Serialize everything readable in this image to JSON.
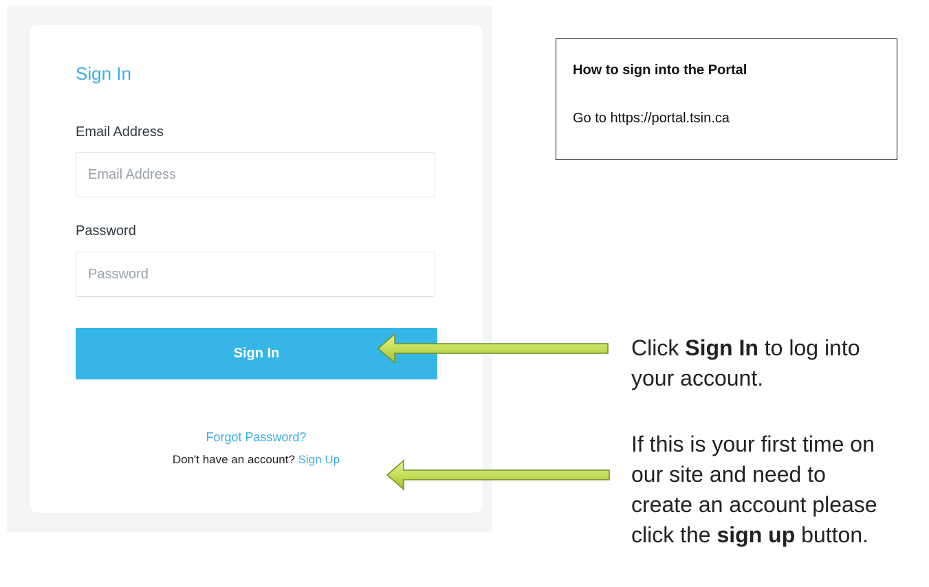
{
  "login_card": {
    "title": "Sign In",
    "email_label": "Email Address",
    "email_placeholder": "Email Address",
    "email_value": "",
    "password_label": "Password",
    "password_placeholder": "Password",
    "password_value": "",
    "signin_button": "Sign In",
    "forgot_link": "Forgot Password?",
    "signup_prompt": "Don't have an account?",
    "signup_link": "Sign Up"
  },
  "info_box": {
    "heading": "How to sign into the Portal",
    "text": "Go to https://portal.tsin.ca"
  },
  "callouts": {
    "signin": {
      "prefix": "Click ",
      "bold": "Sign In",
      "suffix_line1": " to log into",
      "line2": "your account."
    },
    "signup": {
      "line1": "If this is your first time on",
      "line2": "our site and need to",
      "line3": "create an account please",
      "line4_prefix": "click the ",
      "line4_bold": "sign up",
      "line4_suffix": " button."
    }
  },
  "colors": {
    "accent": "#3aaee3",
    "button": "#35b6e6",
    "arrow_fill": "#c5de5a",
    "arrow_stroke": "#6e8f24"
  },
  "icons": {
    "signin_arrow": "left-arrow-icon",
    "signup_arrow": "left-arrow-icon"
  }
}
